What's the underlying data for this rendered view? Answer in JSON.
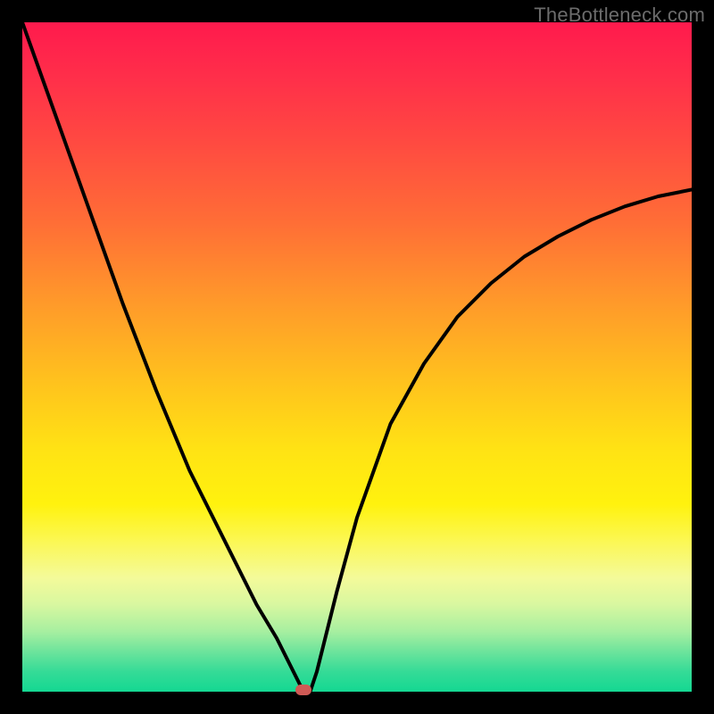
{
  "watermark": "TheBottleneck.com",
  "colors": {
    "frame": "#000000",
    "curve": "#000000",
    "marker": "#cf5a55"
  },
  "chart_data": {
    "type": "line",
    "title": "",
    "xlabel": "",
    "ylabel": "",
    "xlim": [
      0,
      100
    ],
    "ylim": [
      0,
      100
    ],
    "grid": false,
    "legend": false,
    "series": [
      {
        "name": "bottleneck-curve",
        "x": [
          0,
          5,
          10,
          15,
          20,
          25,
          30,
          35,
          38,
          40,
          41,
          42,
          43,
          44,
          47,
          50,
          55,
          60,
          65,
          70,
          75,
          80,
          85,
          90,
          95,
          100
        ],
        "values": [
          100,
          86,
          72,
          58,
          45,
          33,
          23,
          13,
          8,
          4,
          2,
          0,
          0,
          3,
          15,
          26,
          40,
          49,
          56,
          61,
          65,
          68,
          70.5,
          72.5,
          74,
          75
        ]
      }
    ],
    "marker": {
      "x": 42,
      "y": 0
    },
    "gradient_stops": [
      {
        "pos": 0,
        "color": "#ff1a4d"
      },
      {
        "pos": 50,
        "color": "#ffd11a"
      },
      {
        "pos": 80,
        "color": "#fff766"
      },
      {
        "pos": 100,
        "color": "#14d892"
      }
    ]
  }
}
